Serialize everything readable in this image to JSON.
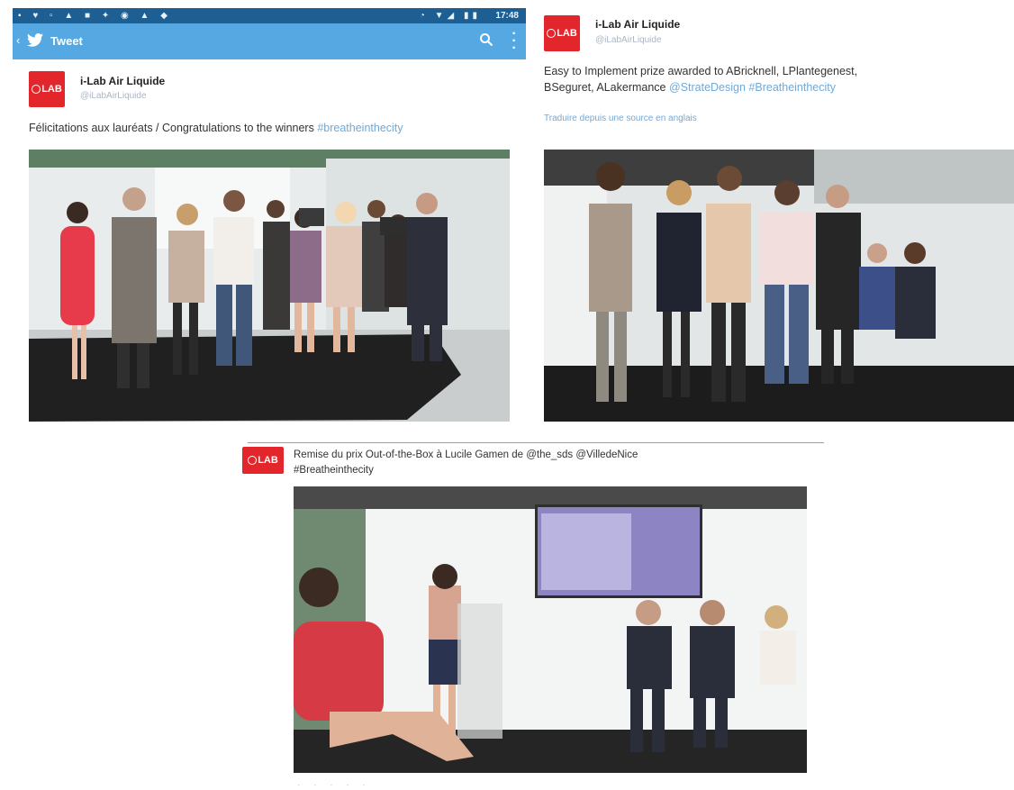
{
  "card1": {
    "status_bar": {
      "left_icons": [
        "notification-icon",
        "twitter-icon",
        "notification-icon",
        "notification-icon",
        "notification-icon",
        "notification-icon",
        "notification-icon",
        "notification-icon"
      ],
      "right_icons": [
        "signal-icon",
        "wifi-icon",
        "battery-icon"
      ],
      "time": "17:48"
    },
    "app_bar": {
      "title": "Tweet"
    },
    "author": {
      "avatar_text": "LAB",
      "name": "i-Lab Air Liquide",
      "handle": "@iLabAirLiquide"
    },
    "text": "Félicitations aux lauréats / Congratulations to the winners",
    "hashtag": "#breatheinthecity"
  },
  "card2": {
    "author": {
      "avatar_text": "LAB",
      "name": "i-Lab Air Liquide",
      "handle": "@iLabAirLiquide"
    },
    "text_line1": "Easy to Implement prize awarded to ABricknell, LPlantegenest,",
    "text_line2_plain": "BSeguret, ALakermance",
    "mention": "@StrateDesign",
    "hashtag": "#Breatheinthecity",
    "translate_link": "Traduire depuis une source en anglais"
  },
  "card3": {
    "author": {
      "avatar_text": "LAB"
    },
    "text_line1": "Remise du prix Out-of-the-Box à Lucile Gamen de @the_sds  @VilledeNice",
    "text_line2": "#Breatheinthecity"
  },
  "colors": {
    "twitter_blue": "#55a8e2",
    "status_bar": "#1d5f93",
    "brand_red": "#e2262b",
    "link_blue": "#6fa9d8"
  }
}
